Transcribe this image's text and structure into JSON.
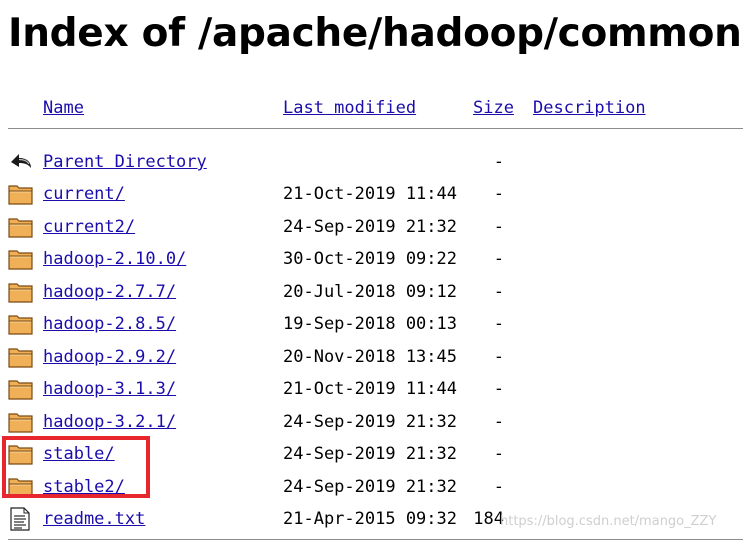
{
  "page": {
    "title": "Index of /apache/hadoop/common"
  },
  "columns": {
    "name": "Name",
    "last_modified": "Last modified",
    "size": "Size",
    "description": "Description"
  },
  "rows": [
    {
      "icon": "back-arrow-icon",
      "name": "Parent Directory",
      "date": "",
      "size": "-"
    },
    {
      "icon": "folder-icon",
      "name": "current/",
      "date": "21-Oct-2019 11:44",
      "size": "-"
    },
    {
      "icon": "folder-icon",
      "name": "current2/",
      "date": "24-Sep-2019 21:32",
      "size": "-"
    },
    {
      "icon": "folder-icon",
      "name": "hadoop-2.10.0/",
      "date": "30-Oct-2019 09:22",
      "size": "-"
    },
    {
      "icon": "folder-icon",
      "name": "hadoop-2.7.7/",
      "date": "20-Jul-2018 09:12",
      "size": "-"
    },
    {
      "icon": "folder-icon",
      "name": "hadoop-2.8.5/",
      "date": "19-Sep-2018 00:13",
      "size": "-"
    },
    {
      "icon": "folder-icon",
      "name": "hadoop-2.9.2/",
      "date": "20-Nov-2018 13:45",
      "size": "-"
    },
    {
      "icon": "folder-icon",
      "name": "hadoop-3.1.3/",
      "date": "21-Oct-2019 11:44",
      "size": "-"
    },
    {
      "icon": "folder-icon",
      "name": "hadoop-3.2.1/",
      "date": "24-Sep-2019 21:32",
      "size": "-"
    },
    {
      "icon": "folder-icon",
      "name": "stable/",
      "date": "24-Sep-2019 21:32",
      "size": "-"
    },
    {
      "icon": "folder-icon",
      "name": "stable2/",
      "date": "24-Sep-2019 21:32",
      "size": "-"
    },
    {
      "icon": "text-file-icon",
      "name": "readme.txt",
      "date": "21-Apr-2015 09:32",
      "size": "184"
    }
  ],
  "watermark": "https://blog.csdn.net/mango_ZZY",
  "colors": {
    "link": "#1a0dab",
    "highlight": "#e8262d",
    "folder": "#f0b057",
    "rule": "#8c8c8c"
  }
}
